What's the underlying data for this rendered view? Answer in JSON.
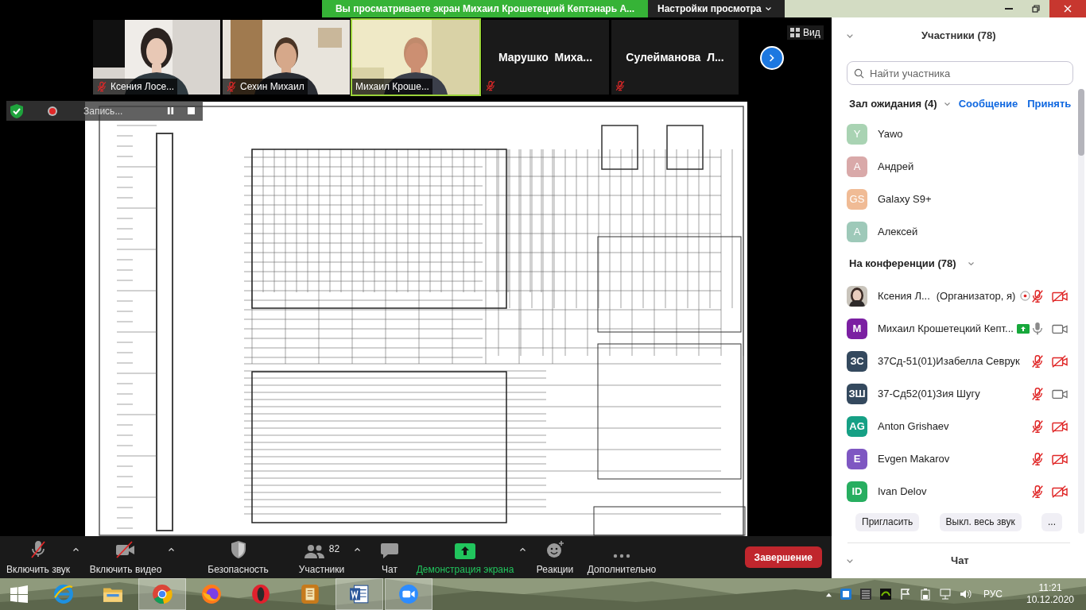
{
  "banner": {
    "text": "Вы просматриваете экран Михаил Крошетецкий Кептэнарь А...",
    "settings_button": "Настройки просмотра"
  },
  "video_tiles": [
    {
      "kind": "video",
      "name": "Ксения Лосе...",
      "muted": true
    },
    {
      "kind": "video",
      "name": "Сехин Михаил",
      "muted": true
    },
    {
      "kind": "video",
      "name": "Михаил Кроше...",
      "muted": false
    },
    {
      "kind": "name",
      "name": "Марушко  Миха...",
      "muted": true
    },
    {
      "kind": "name",
      "name": "Сулейманова  Л...",
      "muted": true
    }
  ],
  "view_button": "Вид",
  "recording": {
    "label": "Запись..."
  },
  "toolbar": [
    {
      "kind": "mic_off",
      "label": "Включить звук",
      "caret": true
    },
    {
      "kind": "video_off",
      "label": "Включить видео",
      "caret": true
    },
    {
      "kind": "security",
      "label": "Безопасность",
      "caret": false
    },
    {
      "kind": "participants",
      "label": "Участники",
      "count": "82",
      "caret": true
    },
    {
      "kind": "chat",
      "label": "Чат",
      "caret": false
    },
    {
      "kind": "share",
      "label": "Демонстрация экрана",
      "caret": true
    },
    {
      "kind": "reactions",
      "label": "Реакции",
      "caret": false
    },
    {
      "kind": "more",
      "label": "Дополнительно",
      "caret": false
    }
  ],
  "end_button": "Завершение",
  "panel": {
    "title": "Участники (78)",
    "search": {
      "placeholder": "Найти участника"
    },
    "waiting": {
      "label": "Зал ожидания (4)",
      "actions": [
        "Сообщение",
        "Принять"
      ],
      "people": [
        {
          "initials": "Y",
          "name": "Yawo",
          "color": "#a9d3b3"
        },
        {
          "initials": "A",
          "name": "Андрей",
          "color": "#d9a9a9"
        },
        {
          "initials": "GS",
          "name": "Galaxy S9+",
          "color": "#f0bb95"
        },
        {
          "initials": "A",
          "name": "Алексей",
          "color": "#9ec9b9"
        }
      ]
    },
    "in_meeting": {
      "label": "На конференции (78)",
      "people": [
        {
          "name": "Ксения Л...",
          "role": "(Организатор, я)",
          "recording": true,
          "sharing": false,
          "muted": true,
          "video_off": true
        },
        {
          "kind": "initials",
          "initials": "M",
          "color": "#7b1fa2",
          "name": "Михаил Крошетецкий Кепт...",
          "recording": false,
          "sharing": true,
          "muted": false,
          "video_off": false
        },
        {
          "kind": "initials",
          "initials": "ЗС",
          "color": "#34495e",
          "name": "37Сд-51(01)Изабелла Севрук",
          "recording": false,
          "sharing": false,
          "muted": true,
          "video_off": true
        },
        {
          "kind": "initials",
          "initials": "ЗШ",
          "color": "#34495e",
          "name": "37-Сд52(01)Зия Шугу",
          "recording": false,
          "sharing": false,
          "muted": true,
          "video_off": false
        },
        {
          "kind": "initials",
          "initials": "AG",
          "color": "#16a085",
          "name": "Anton Grishaev",
          "recording": false,
          "sharing": false,
          "muted": true,
          "video_off": true
        },
        {
          "kind": "initials",
          "initials": "E",
          "color": "#7e57c2",
          "name": "Evgen Makarov",
          "recording": false,
          "sharing": false,
          "muted": true,
          "video_off": true
        },
        {
          "kind": "initials",
          "initials": "ID",
          "color": "#27ae60",
          "name": "Ivan Delov",
          "recording": false,
          "sharing": false,
          "muted": true,
          "video_off": true
        }
      ]
    },
    "buttons": [
      "Пригласить",
      "Выкл. весь звук",
      "..."
    ],
    "chat_title": "Чат"
  },
  "taskbar": {
    "apps": [
      {
        "open": false
      },
      {
        "open": false
      },
      {
        "open": true
      },
      {
        "open": false
      },
      {
        "open": false
      },
      {
        "open": false
      },
      {
        "open": true
      },
      {
        "open": true
      }
    ],
    "language": "РУС",
    "time": "11:21",
    "date": "10.12.2020"
  }
}
